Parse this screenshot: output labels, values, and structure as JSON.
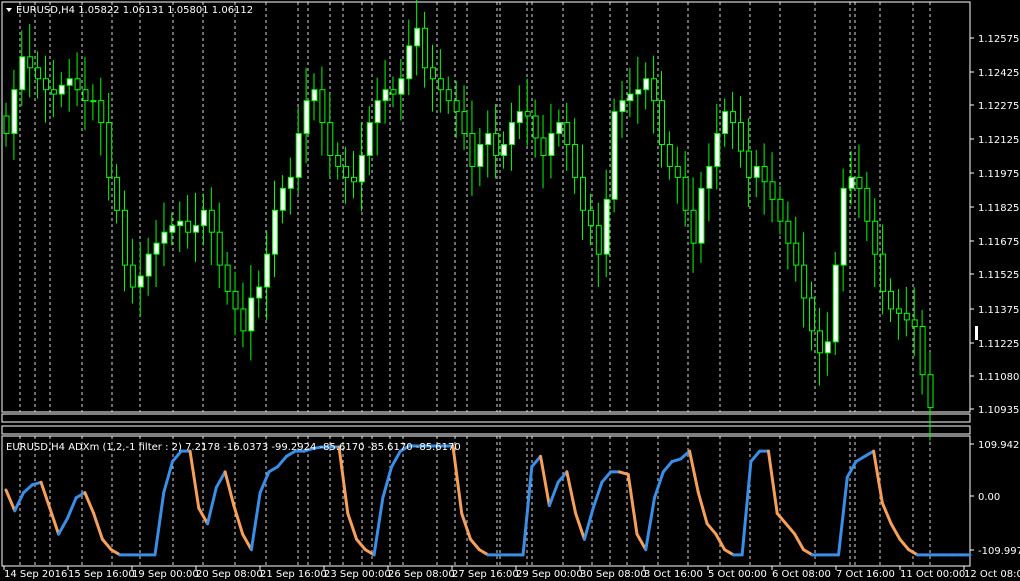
{
  "main": {
    "title": "EURUSD,H4  1.05822 1.06131 1.05801 1.06112",
    "price_ticks": [
      "1.12575",
      "1.12425",
      "1.12275",
      "1.12125",
      "1.11975",
      "1.11825",
      "1.11675",
      "1.11525",
      "1.11375",
      "1.11225",
      "1.11080",
      "1.10935"
    ],
    "colors": {
      "bull": "#ffffff",
      "bear": "#ffffff",
      "wick": "#00ff00",
      "grid": "#ffffff",
      "frame": "#ffffff",
      "background": "#000000"
    }
  },
  "indicator": {
    "title": "EURUSD,H4 ADXm (1,2,-1 filter : 2) 7.2178 -16.0373 -99.2924 -85.6170 -85.6170 -85.6170",
    "ticks": [
      "109.942",
      "0.00",
      "-109.997"
    ],
    "colors": {
      "rising": "#3a8ee6",
      "falling": "#f5a05a"
    }
  },
  "time_axis": {
    "labels": [
      "14 Sep 2016",
      "15 Sep 16:00",
      "19 Sep 00:00",
      "20 Sep 08:00",
      "21 Sep 16:00",
      "23 Sep 00:00",
      "26 Sep 08:00",
      "27 Sep 16:00",
      "29 Sep 00:00",
      "30 Sep 08:00",
      "3 Oct 16:00",
      "5 Oct 00:00",
      "6 Oct 08:00",
      "7 Oct 16:00",
      "11 Oct 00:00",
      "12 Oct 08:00"
    ]
  },
  "chart_data": [
    {
      "type": "candlestick",
      "title": "EURUSD,H4  1.05822 1.06131 1.05801 1.06112",
      "ylim": [
        1.1093,
        1.128
      ],
      "close_series": [
        1.122,
        1.124,
        1.1255,
        1.125,
        1.1245,
        1.124,
        1.1238,
        1.1242,
        1.1245,
        1.124,
        1.1235,
        1.1235,
        1.1225,
        1.12,
        1.1185,
        1.116,
        1.115,
        1.1155,
        1.1165,
        1.117,
        1.1175,
        1.1178,
        1.118,
        1.1175,
        1.1178,
        1.1185,
        1.1175,
        1.116,
        1.1148,
        1.114,
        1.113,
        1.1145,
        1.115,
        1.1165,
        1.1185,
        1.1195,
        1.12,
        1.122,
        1.1235,
        1.124,
        1.1225,
        1.121,
        1.1205,
        1.12,
        1.1198,
        1.121,
        1.1225,
        1.1235,
        1.124,
        1.1238,
        1.1245,
        1.126,
        1.1268,
        1.125,
        1.1245,
        1.124,
        1.1235,
        1.123,
        1.122,
        1.1205,
        1.1215,
        1.122,
        1.121,
        1.1215,
        1.1225,
        1.123,
        1.1228,
        1.1218,
        1.121,
        1.122,
        1.1225,
        1.1215,
        1.12,
        1.1185,
        1.1178,
        1.1165,
        1.119,
        1.123,
        1.1235,
        1.1238,
        1.124,
        1.1245,
        1.1235,
        1.1215,
        1.1205,
        1.12,
        1.1185,
        1.117,
        1.1195,
        1.1205,
        1.122,
        1.123,
        1.1225,
        1.1212,
        1.12,
        1.1205,
        1.1198,
        1.119,
        1.118,
        1.117,
        1.116,
        1.1145,
        1.113,
        1.112,
        1.1125,
        1.116,
        1.1195,
        1.12,
        1.1195,
        1.118,
        1.1165,
        1.1148,
        1.114,
        1.1138,
        1.1135,
        1.1132,
        1.111,
        1.1095
      ],
      "series": [
        {
          "values": [
            1.122,
            1.124,
            1.1255,
            1.125,
            1.1245,
            1.124,
            1.1238,
            1.1242,
            1.1245,
            1.124,
            1.1235,
            1.1235,
            1.1225,
            1.12,
            1.1185,
            1.116,
            1.115,
            1.1155,
            1.1165,
            1.117,
            1.1175,
            1.1178,
            1.118,
            1.1175,
            1.1178,
            1.1185,
            1.1175,
            1.116,
            1.1148,
            1.114,
            1.113,
            1.1145,
            1.115,
            1.1165,
            1.1185,
            1.1195,
            1.12,
            1.122,
            1.1235,
            1.124,
            1.1225,
            1.121,
            1.1205,
            1.12,
            1.1198,
            1.121,
            1.1225,
            1.1235,
            1.124,
            1.1238,
            1.1245,
            1.126,
            1.1268,
            1.125,
            1.1245,
            1.124,
            1.1235,
            1.123,
            1.122,
            1.1205,
            1.1215,
            1.122,
            1.121,
            1.1215,
            1.1225,
            1.123,
            1.1228,
            1.1218,
            1.121,
            1.122,
            1.1225,
            1.1215,
            1.12,
            1.1185,
            1.1178,
            1.1165,
            1.119,
            1.123,
            1.1235,
            1.1238,
            1.124,
            1.1245,
            1.1235,
            1.1215,
            1.1205,
            1.12,
            1.1185,
            1.117,
            1.1195,
            1.1205,
            1.122,
            1.123,
            1.1225,
            1.1212,
            1.12,
            1.1205,
            1.1198,
            1.119,
            1.118,
            1.117,
            1.116,
            1.1145,
            1.113,
            1.112,
            1.1125,
            1.116,
            1.1195,
            1.12,
            1.1195,
            1.118,
            1.1165,
            1.1148,
            1.114,
            1.1138,
            1.1135,
            1.1132,
            1.111,
            1.1095
          ]
        }
      ]
    },
    {
      "type": "line",
      "title": "EURUSD,H4 ADXm (1,2,-1 filter : 2) 7.2178 -16.0373 -99.2924 -85.6170 -85.6170 -85.6170",
      "ylim": [
        -109.997,
        109.942
      ],
      "values": [
        25,
        -15,
        20,
        35,
        40,
        -10,
        -60,
        -30,
        10,
        20,
        -20,
        -70,
        -90,
        -100,
        -100,
        -100,
        -100,
        -100,
        20,
        80,
        100,
        100,
        -10,
        -40,
        30,
        60,
        -5,
        -60,
        -90,
        20,
        60,
        70,
        90,
        100,
        100,
        105,
        108,
        108,
        108,
        -20,
        -70,
        -90,
        -100,
        10,
        70,
        100,
        110,
        110,
        110,
        110,
        110,
        110,
        -20,
        -70,
        -90,
        -100,
        -100,
        -100,
        -100,
        -100,
        70,
        90,
        -5,
        40,
        60,
        -20,
        -70,
        -10,
        40,
        60,
        60,
        55,
        -60,
        -90,
        10,
        60,
        80,
        85,
        100,
        20,
        -40,
        -60,
        -90,
        -100,
        -100,
        80,
        100,
        100,
        -20,
        -40,
        -60,
        -90,
        -100,
        -100,
        -100,
        -100,
        50,
        80,
        90,
        100,
        0,
        -40,
        -70,
        -90,
        -100,
        -100,
        -100,
        -100,
        -100,
        -100,
        -100
      ]
    }
  ]
}
